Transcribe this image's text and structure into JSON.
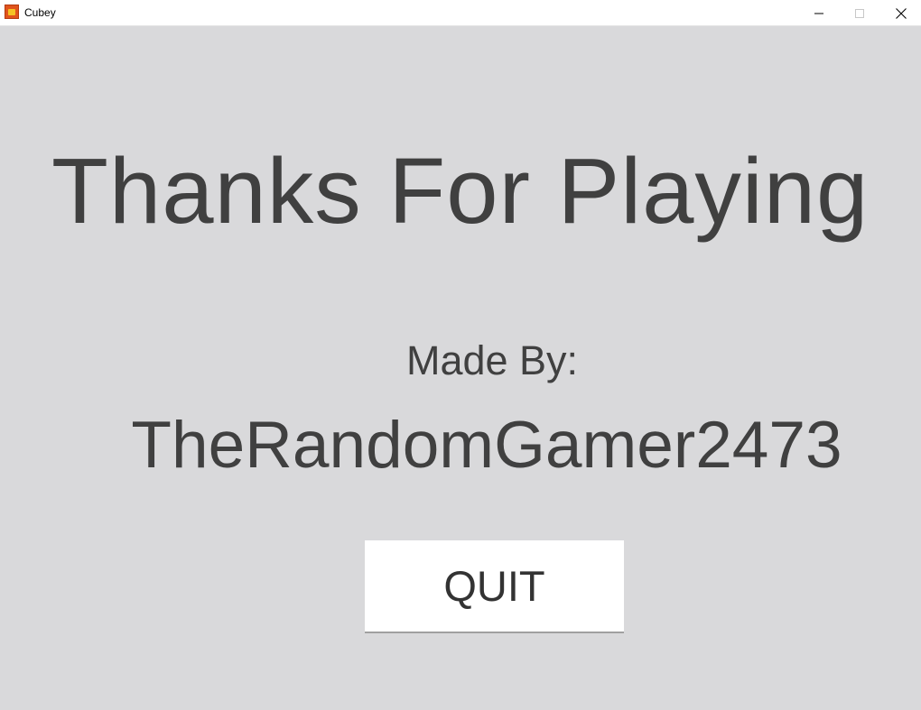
{
  "window": {
    "title": "Cubey",
    "icon": "cubey-app-icon",
    "controls": {
      "minimize_icon": "minimize-icon",
      "maximize_icon": "maximize-icon",
      "close_icon": "close-icon"
    }
  },
  "screen": {
    "headline": "Thanks For Playing",
    "credit_label": "Made By:",
    "author": "TheRandomGamer2473",
    "quit_label": "QUIT"
  },
  "colors": {
    "background": "#d9d9db",
    "text": "#404040",
    "button_background": "#ffffff"
  }
}
